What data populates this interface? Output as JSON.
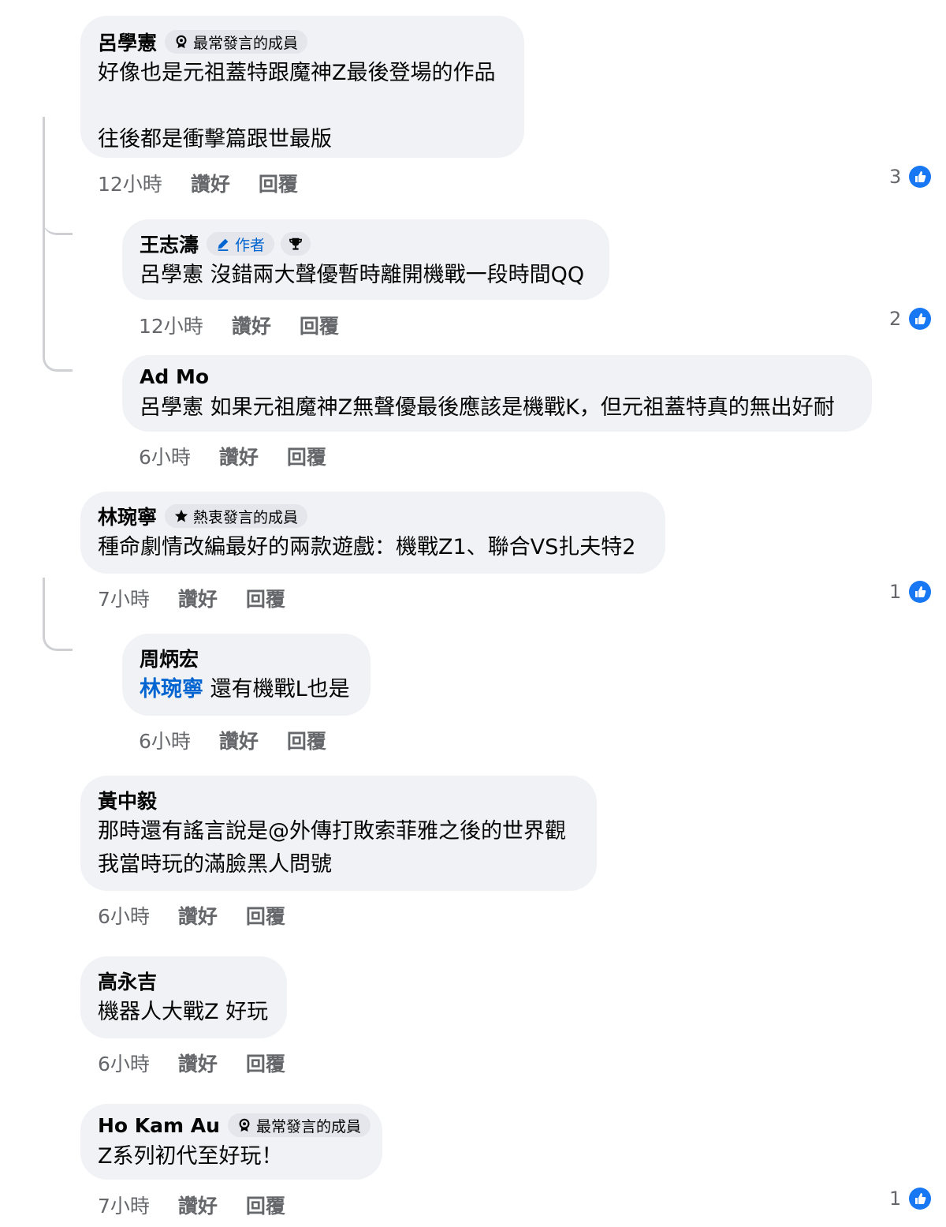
{
  "comments": [
    {
      "author": "呂學憲",
      "badge": "最常發言的成員",
      "text": "好像也是元祖蓋特跟魔神Z最後登場的作品\n\n往後都是衝擊篇跟世最版",
      "time": "12小時",
      "like": "讚好",
      "reply": "回覆",
      "reactions": "3"
    },
    {
      "author": "王志濤",
      "badge": "作者",
      "mention": "呂學憲",
      "text": " 沒錯兩大聲優暫時離開機戰一段時間QQ",
      "time": "12小時",
      "like": "讚好",
      "reply": "回覆",
      "reactions": "2"
    },
    {
      "author": "Ad Mo",
      "mention": "呂學憲",
      "text": " 如果元祖魔神Z無聲優最後應該是機戰K，但元祖蓋特真的無出好耐",
      "time": "6小時",
      "like": "讚好",
      "reply": "回覆"
    },
    {
      "author": "林琬寧",
      "badge": "熱衷發言的成員",
      "text": "種命劇情改編最好的兩款遊戲：機戰Z1、聯合VS扎夫特2",
      "time": "7小時",
      "like": "讚好",
      "reply": "回覆",
      "reactions": "1"
    },
    {
      "author": "周炳宏",
      "mention": "林琬寧",
      "text": " 還有機戰L也是",
      "time": "6小時",
      "like": "讚好",
      "reply": "回覆"
    },
    {
      "author": "黃中毅",
      "text": "那時還有謠言說是@外傳打敗索菲雅之後的世界觀\n我當時玩的滿臉黑人問號",
      "time": "6小時",
      "like": "讚好",
      "reply": "回覆"
    },
    {
      "author": "高永吉",
      "text": "機器人大戰Z 好玩",
      "time": "6小時",
      "like": "讚好",
      "reply": "回覆"
    },
    {
      "author": "Ho Kam Au",
      "badge": "最常發言的成員",
      "text": "Z系列初代至好玩！",
      "time": "7小時",
      "like": "讚好",
      "reply": "回覆",
      "reactions": "1"
    }
  ],
  "colors": {
    "bubble": "#f0f2f5",
    "badge_bg": "#e4e6eb",
    "link_blue": "#0064d1",
    "meta_gray": "#65676b",
    "like_blue": "#1877f2"
  },
  "icons": {
    "top_contributor": "ribbon-medal-icon",
    "author": "pencil-icon",
    "trophy": "trophy-icon",
    "rising": "star-icon",
    "like": "thumbs-up-icon"
  }
}
